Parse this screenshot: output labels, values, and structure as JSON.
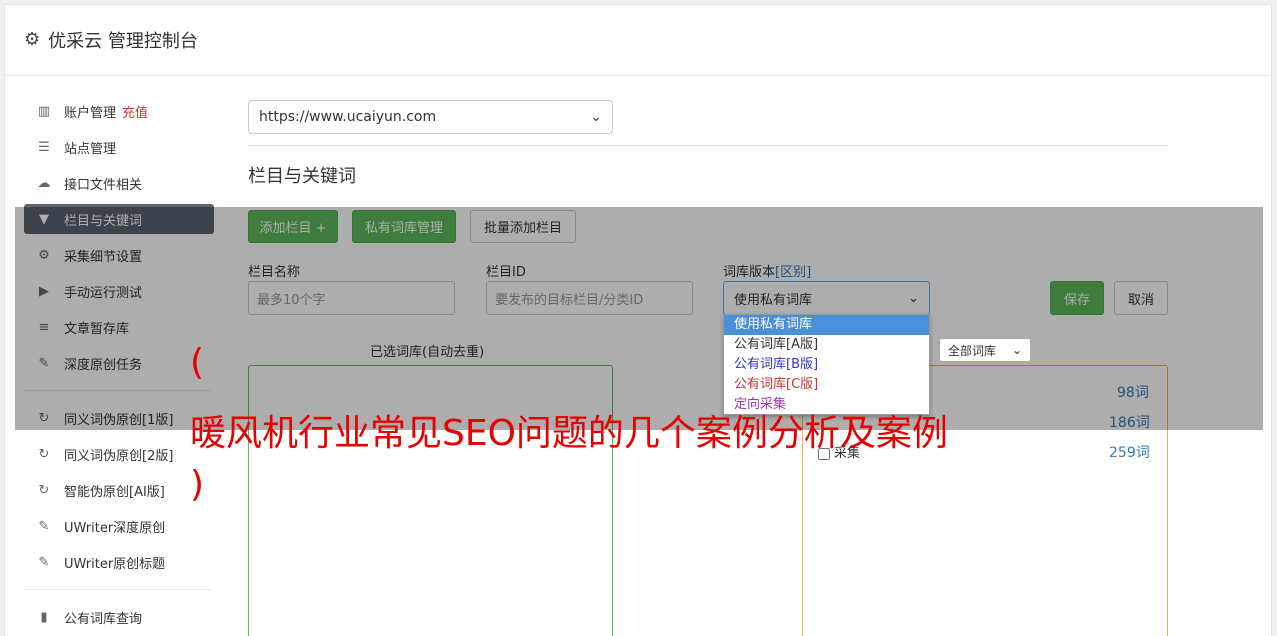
{
  "header": {
    "icon": "gear-icon",
    "title": "优采云 管理控制台"
  },
  "sidebar": {
    "items": [
      {
        "icon": "bar-chart-icon",
        "label": "账户管理",
        "extra": "充值"
      },
      {
        "icon": "server-icon",
        "label": "站点管理"
      },
      {
        "icon": "cloud-upload-icon",
        "label": "接口文件相关"
      },
      {
        "icon": "filter-icon",
        "label": "栏目与关键词",
        "active": true
      },
      {
        "icon": "gears-icon",
        "label": "采集细节设置"
      },
      {
        "icon": "play-circle-icon",
        "label": "手动运行测试"
      },
      {
        "icon": "database-icon",
        "label": "文章暂存库"
      },
      {
        "icon": "edit-icon",
        "label": "深度原创任务"
      }
    ],
    "items2": [
      {
        "icon": "refresh-icon",
        "label": "同义词伪原创[1版]"
      },
      {
        "icon": "refresh-icon",
        "label": "同义词伪原创[2版]"
      },
      {
        "icon": "refresh-icon",
        "label": "智能伪原创[AI版]"
      },
      {
        "icon": "edit-icon",
        "label": "UWriter深度原创"
      },
      {
        "icon": "edit-icon",
        "label": "UWriter原创标题"
      }
    ],
    "items3": [
      {
        "icon": "book-icon",
        "label": "公有词库查询"
      }
    ]
  },
  "main": {
    "site_select": "https://www.ucaiyun.com",
    "section_title": "栏目与关键词",
    "buttons": {
      "add_column": "添加栏目 +",
      "private_lib": "私有词库管理",
      "batch_add": "批量添加栏目"
    },
    "fields": {
      "column_name_label": "栏目名称",
      "column_name_placeholder": "最多10个字",
      "column_id_label": "栏目ID",
      "column_id_placeholder": "要发布的目标栏目/分类ID",
      "lib_version_label": "词库版本",
      "lib_version_link": "[区别]",
      "lib_version_value": "使用私有词库"
    },
    "save": "保存",
    "cancel": "取消",
    "selected_lib_label": "已选词库(自动去重)",
    "filter_select": "全部词库",
    "dropdown_options": [
      {
        "label": "使用私有词库",
        "color": "#ffffff"
      },
      {
        "label": "公有词库[A版]",
        "color": "#333333"
      },
      {
        "label": "公有词库[B版]",
        "color": "#3333cc"
      },
      {
        "label": "公有词库[C版]",
        "color": "#cc3333"
      },
      {
        "label": "定向采集",
        "color": "#9933cc"
      }
    ],
    "lib_rows": [
      {
        "label": "",
        "count": "98词"
      },
      {
        "label": "",
        "count": "186词"
      },
      {
        "label": "采集",
        "count": "259词"
      }
    ]
  },
  "banner": {
    "open": "(",
    "text": "暖风机行业常见SEO问题的几个案例分析及案例",
    "close": ")"
  }
}
